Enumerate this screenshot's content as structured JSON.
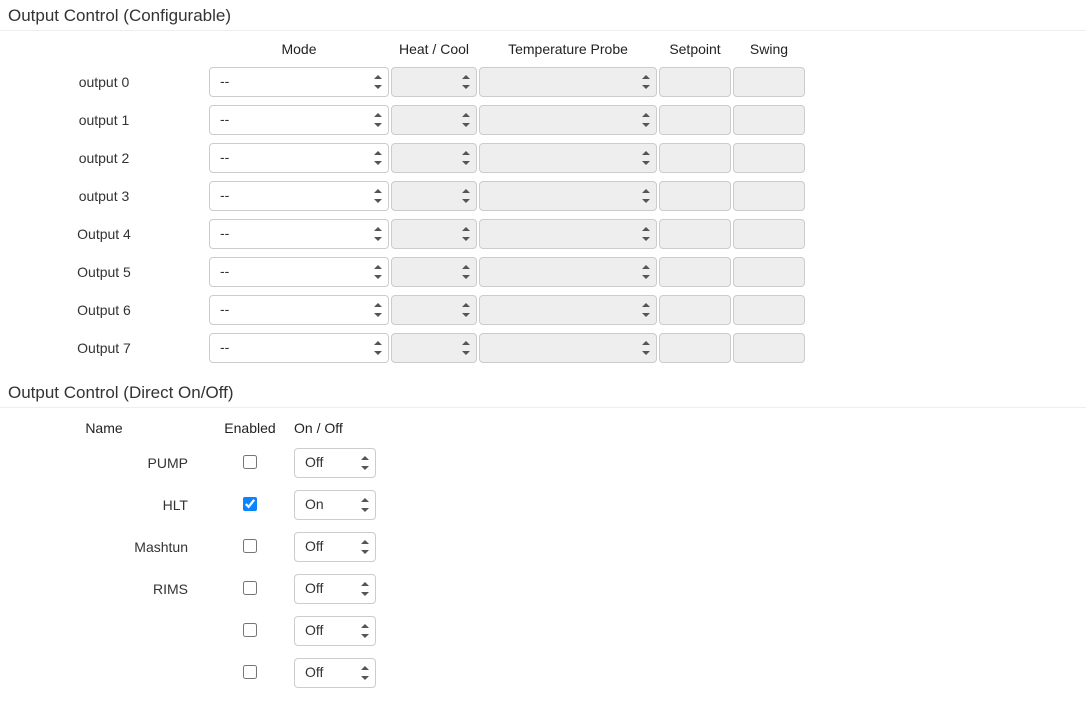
{
  "sections": {
    "configurable": {
      "heading": "Output Control (Configurable)",
      "headers": {
        "mode": "Mode",
        "heatcool": "Heat / Cool",
        "probe": "Temperature Probe",
        "setpoint": "Setpoint",
        "swing": "Swing"
      },
      "rows": [
        {
          "label": "output 0",
          "mode": "--"
        },
        {
          "label": "output 1",
          "mode": "--"
        },
        {
          "label": "output 2",
          "mode": "--"
        },
        {
          "label": "output 3",
          "mode": "--"
        },
        {
          "label": "Output 4",
          "mode": "--"
        },
        {
          "label": "Output 5",
          "mode": "--"
        },
        {
          "label": "Output 6",
          "mode": "--"
        },
        {
          "label": "Output 7",
          "mode": "--"
        }
      ]
    },
    "direct": {
      "heading": "Output Control (Direct On/Off)",
      "headers": {
        "name": "Name",
        "enabled": "Enabled",
        "onoff": "On / Off"
      },
      "rows": [
        {
          "name": "PUMP",
          "enabled": false,
          "state": "Off"
        },
        {
          "name": "HLT",
          "enabled": true,
          "state": "On"
        },
        {
          "name": "Mashtun",
          "enabled": false,
          "state": "Off"
        },
        {
          "name": "RIMS",
          "enabled": false,
          "state": "Off"
        },
        {
          "name": "",
          "enabled": false,
          "state": "Off"
        },
        {
          "name": "",
          "enabled": false,
          "state": "Off"
        }
      ]
    }
  }
}
